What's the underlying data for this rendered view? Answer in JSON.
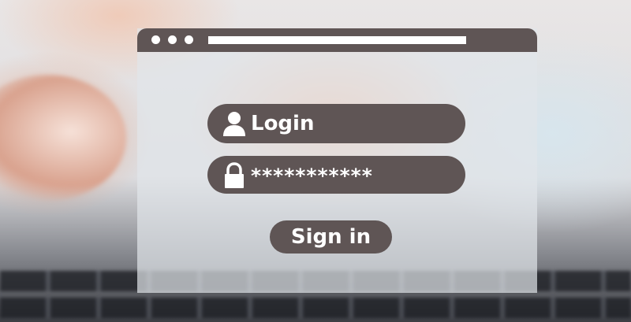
{
  "browser": {
    "window_controls": [
      "close-dot",
      "minimize-dot",
      "maximize-dot"
    ]
  },
  "login_field": {
    "icon": "user-icon",
    "value": "Login"
  },
  "password_field": {
    "icon": "lock-icon",
    "value": "***********"
  },
  "sign_in_button": {
    "label": "Sign in"
  },
  "colors": {
    "accent": "#5f5555",
    "text": "#ffffff",
    "panel": "#e1e6ea"
  }
}
